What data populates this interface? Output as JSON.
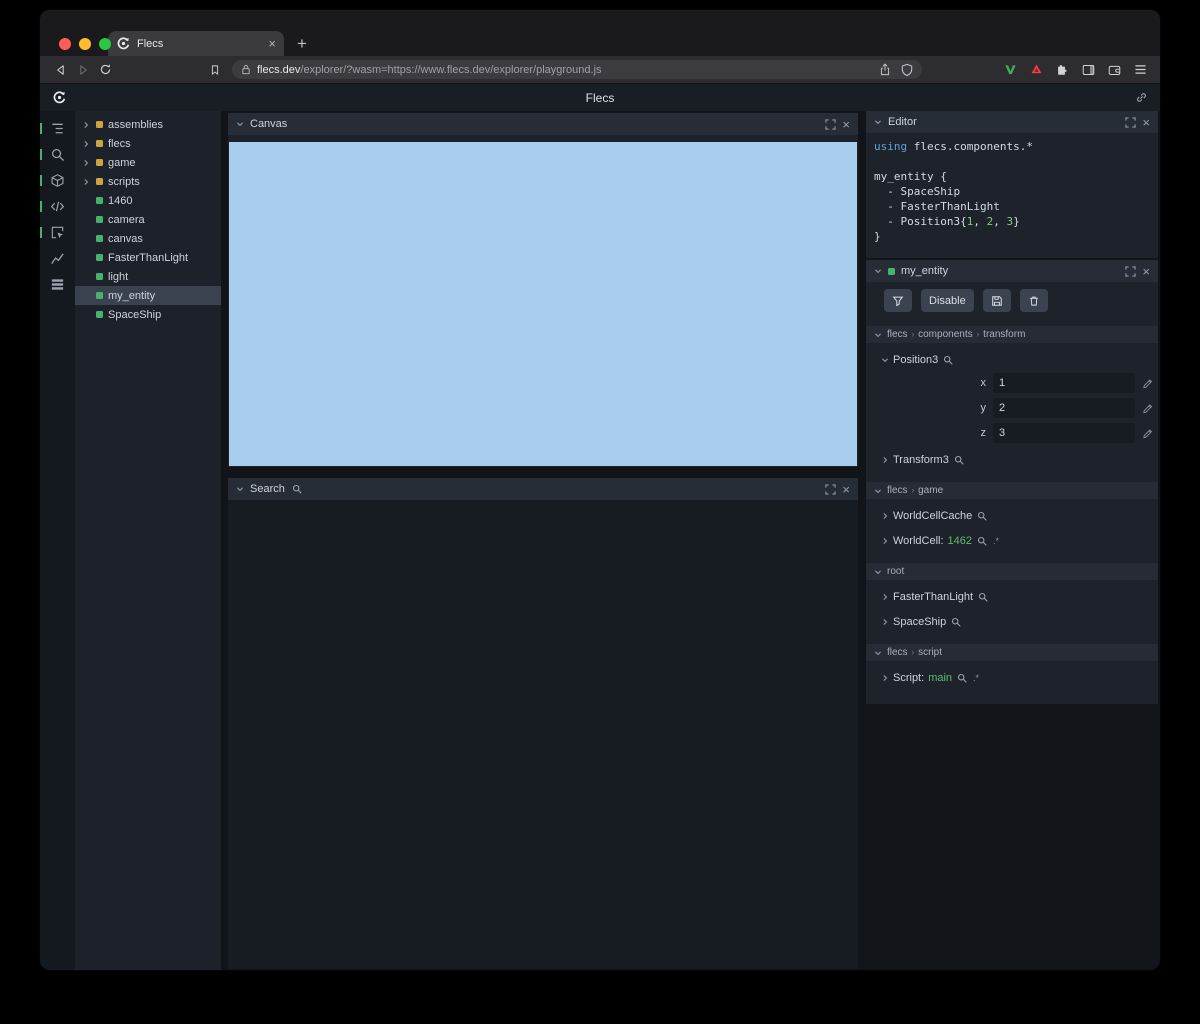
{
  "glyphs": {
    "plus": "+",
    "close": "×"
  },
  "browser": {
    "tab_title": "Flecs",
    "url_domain": "flecs.dev",
    "url_rest": "/explorer/?wasm=https://www.flecs.dev/explorer/playground.js"
  },
  "app_header": {
    "title": "Flecs"
  },
  "rail": {
    "items": [
      {
        "name": "entity-tree-toggle",
        "icon": "tree",
        "active": true
      },
      {
        "name": "query-search-toggle",
        "icon": "search",
        "active": true
      },
      {
        "name": "canvas-toggle",
        "icon": "cube",
        "active": true
      },
      {
        "name": "editor-toggle",
        "icon": "code",
        "active": true
      },
      {
        "name": "inspector-toggle",
        "icon": "inspect",
        "active": true
      },
      {
        "name": "stats-chart-toggle",
        "icon": "chart",
        "active": false
      },
      {
        "name": "tables-toggle",
        "icon": "rows",
        "active": false
      }
    ]
  },
  "tree": {
    "items": [
      {
        "label": "assemblies",
        "kind": "module",
        "expandable": true
      },
      {
        "label": "flecs",
        "kind": "module",
        "expandable": true
      },
      {
        "label": "game",
        "kind": "module",
        "expandable": true
      },
      {
        "label": "scripts",
        "kind": "module",
        "expandable": true
      },
      {
        "label": "1460",
        "kind": "entity"
      },
      {
        "label": "camera",
        "kind": "entity"
      },
      {
        "label": "canvas",
        "kind": "entity"
      },
      {
        "label": "FasterThanLight",
        "kind": "entity"
      },
      {
        "label": "light",
        "kind": "entity"
      },
      {
        "label": "my_entity",
        "kind": "entity",
        "selected": true
      },
      {
        "label": "SpaceShip",
        "kind": "entity"
      }
    ]
  },
  "panels": {
    "canvas": {
      "title": "Canvas"
    },
    "search": {
      "title": "Search"
    },
    "editor": {
      "title": "Editor",
      "code": [
        [
          {
            "t": "using",
            "c": "kw"
          },
          {
            "t": " flecs.components.*",
            "c": "plain"
          }
        ],
        [],
        [
          {
            "t": "my_entity {",
            "c": "plain"
          }
        ],
        [
          {
            "t": "  - SpaceShip",
            "c": "plain"
          }
        ],
        [
          {
            "t": "  - FasterThanLight",
            "c": "plain"
          }
        ],
        [
          {
            "t": "  - Position3{",
            "c": "plain"
          },
          {
            "t": "1",
            "c": "num"
          },
          {
            "t": ", ",
            "c": "plain"
          },
          {
            "t": "2",
            "c": "num"
          },
          {
            "t": ", ",
            "c": "plain"
          },
          {
            "t": "3",
            "c": "num"
          },
          {
            "t": "}",
            "c": "plain"
          }
        ],
        [
          {
            "t": "}",
            "c": "plain"
          }
        ]
      ]
    },
    "inspector": {
      "title": "my_entity",
      "toolbar": {
        "disable_label": "Disable"
      },
      "path_separator": "›",
      "sections": [
        {
          "path": [
            "flecs",
            "components",
            "transform"
          ],
          "items": [
            {
              "label": "Position3",
              "expanded": true,
              "fields": [
                {
                  "name": "x",
                  "value": "1"
                },
                {
                  "name": "y",
                  "value": "2"
                },
                {
                  "name": "z",
                  "value": "3"
                }
              ]
            },
            {
              "label": "Transform3"
            }
          ]
        },
        {
          "path": [
            "flecs",
            "game"
          ],
          "items": [
            {
              "label": "WorldCellCache"
            },
            {
              "label": "WorldCell",
              "value": "1462",
              "expr": ".*"
            }
          ]
        },
        {
          "path": [
            "root"
          ],
          "items": [
            {
              "label": "FasterThanLight"
            },
            {
              "label": "SpaceShip"
            }
          ]
        },
        {
          "path": [
            "flecs",
            "script"
          ],
          "items": [
            {
              "label": "Script",
              "value": "main",
              "expr": ".*"
            }
          ]
        }
      ]
    }
  },
  "colors": {
    "accent_green": "#46b36a",
    "module_yellow": "#cda43f",
    "canvas_blue": "#a8cdef",
    "value_green": "#5abf70",
    "keyword_blue": "#5aa3dd"
  }
}
